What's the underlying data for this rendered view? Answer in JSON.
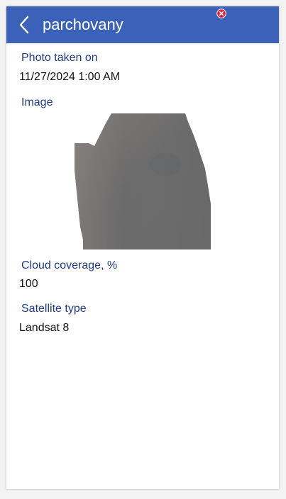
{
  "header": {
    "title": "parchovany",
    "back_icon": "chevron-left-icon",
    "close_icon": "close-circle-icon",
    "accent_color": "#3b61b8",
    "close_color": "#e0243a"
  },
  "fields": {
    "photo_taken": {
      "label": "Photo taken on",
      "value": "11/27/2024 1:00 AM"
    },
    "image": {
      "label": "Image"
    },
    "cloud_coverage": {
      "label": "Cloud coverage, %",
      "value": "100"
    },
    "satellite_type": {
      "label": "Satellite type",
      "value": "Landsat 8"
    }
  }
}
